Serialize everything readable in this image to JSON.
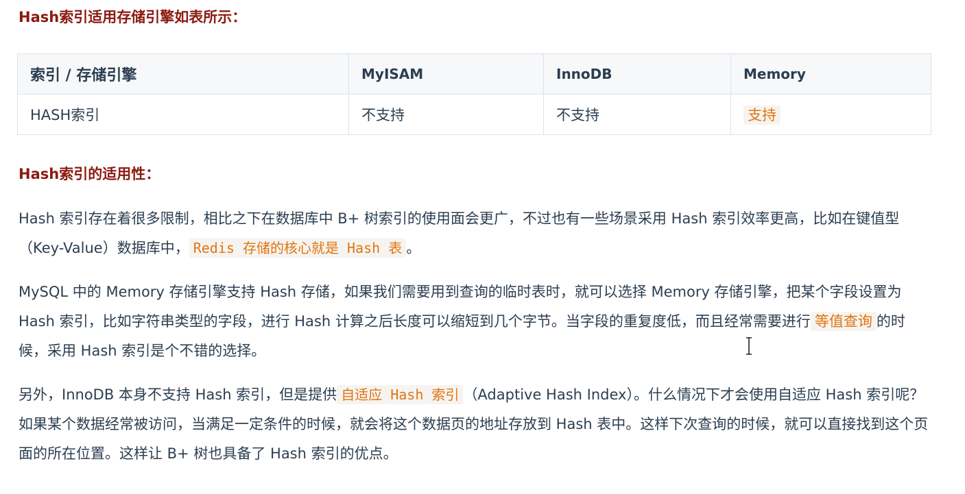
{
  "heading1": "Hash索引适用存储引擎如表所示：",
  "table": {
    "headers": [
      "索引 / 存储引擎",
      "MyISAM",
      "InnoDB",
      "Memory"
    ],
    "rows": [
      [
        "HASH索引",
        "不支持",
        "不支持",
        "支持"
      ]
    ]
  },
  "heading2": "Hash索引的适用性：",
  "para1": {
    "t1": "Hash 索引存在着很多限制，相比之下在数据库中 B+ 树索引的使用面会更广，不过也有一些场景采用 Hash 索引效率更高，比如在键值型（Key-Value）数据库中，",
    "code": "Redis 存储的核心就是 Hash 表",
    "t2": "。"
  },
  "para2": {
    "t1": "MySQL 中的 Memory 存储引擎支持 Hash 存储，如果我们需要用到查询的临时表时，就可以选择 Memory 存储引擎，把某个字段设置为 Hash 索引，比如字符串类型的字段，进行 Hash 计算之后长度可以缩短到几个字节。当字段的重复度低，而且经常需要进行",
    "hl": "等值查询",
    "t2": "的时候，采用 Hash 索引是个不错的选择。"
  },
  "para3": {
    "t1": "另外，InnoDB 本身不支持 Hash 索引，但是提供",
    "code": "自适应 Hash 索引",
    "t2": "（Adaptive Hash Index）。什么情况下才会使用自适应 Hash 索引呢？如果某个数据经常被访问，当满足一定条件的时候，就会将这个数据页的地址存放到 Hash 表中。这样下次查询的时候，就可以直接找到这个页面的所在位置。这样让 B+ 树也具备了 Hash 索引的优点。"
  },
  "colors": {
    "heading": "#8b1a10",
    "text": "#2c3e50",
    "highlight": "#e2740f",
    "highlight_bg": "#f6f4f0",
    "table_header_bg": "#f6f8fa",
    "border": "#dfe2e5"
  },
  "icons": {
    "cursor": "text-cursor-icon"
  }
}
